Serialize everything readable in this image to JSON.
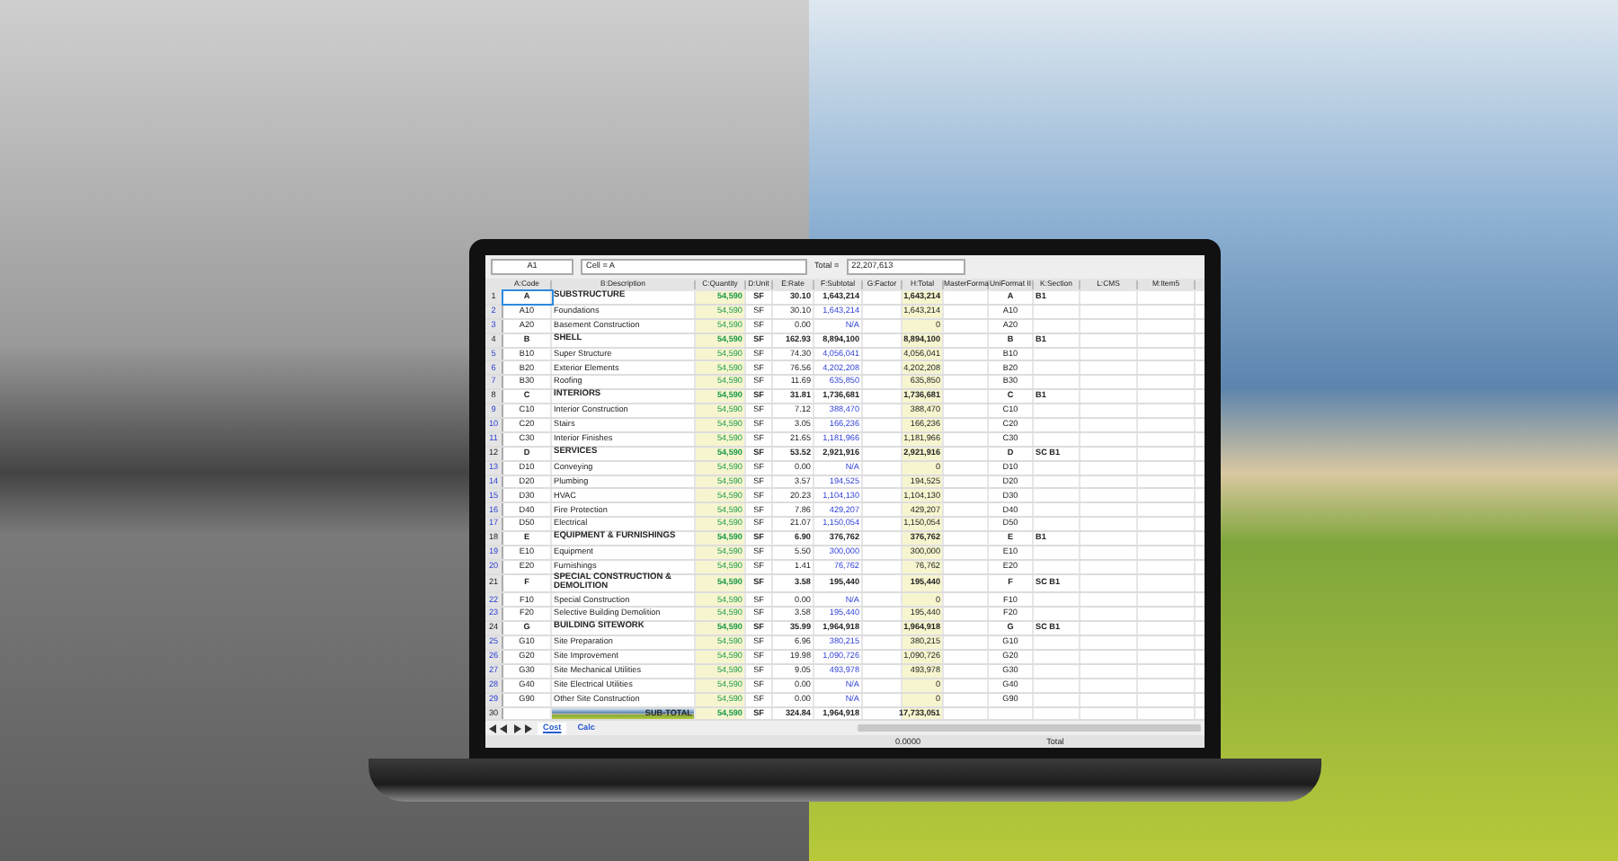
{
  "formula_bar": {
    "cell_ref": "A1",
    "formula": "Cell = A",
    "total_label": "Total =",
    "total_value": "22,207,613"
  },
  "columns": [
    "A:Code",
    "B:Description",
    "C:Quantity",
    "D:Unit",
    "E:Rate",
    "F:Subtotal",
    "G:Factor",
    "H:Total",
    "MasterForma",
    "UniFormat II",
    "K:Section",
    "L:CMS",
    "M:Item5"
  ],
  "rows": [
    {
      "n": "1",
      "kind": "group",
      "selected": true,
      "code": "A",
      "description": "SUBSTRUCTURE",
      "quantity": "54,590",
      "unit": "SF",
      "rate": "30.10",
      "subtotal": "1,643,214",
      "total": "1,643,214",
      "uniformat": "A",
      "section": "B1"
    },
    {
      "n": "2",
      "kind": "item",
      "selected": false,
      "code": "A10",
      "description": "Foundations",
      "quantity": "54,590",
      "unit": "SF",
      "rate": "30.10",
      "subtotal": "1,643,214",
      "total": "1,643,214",
      "uniformat": "A10",
      "section": ""
    },
    {
      "n": "3",
      "kind": "item",
      "selected": false,
      "code": "A20",
      "description": "Basement Construction",
      "quantity": "54,590",
      "unit": "SF",
      "rate": "0.00",
      "subtotal": "N/A",
      "total": "0",
      "uniformat": "A20",
      "section": ""
    },
    {
      "n": "4",
      "kind": "group",
      "selected": false,
      "code": "B",
      "description": "SHELL",
      "quantity": "54,590",
      "unit": "SF",
      "rate": "162.93",
      "subtotal": "8,894,100",
      "total": "8,894,100",
      "uniformat": "B",
      "section": "B1"
    },
    {
      "n": "5",
      "kind": "item",
      "selected": false,
      "code": "B10",
      "description": "Super Structure",
      "quantity": "54,590",
      "unit": "SF",
      "rate": "74.30",
      "subtotal": "4,056,041",
      "total": "4,056,041",
      "uniformat": "B10",
      "section": ""
    },
    {
      "n": "6",
      "kind": "item",
      "selected": false,
      "code": "B20",
      "description": "Exterior Elements",
      "quantity": "54,590",
      "unit": "SF",
      "rate": "76.56",
      "subtotal": "4,202,208",
      "total": "4,202,208",
      "uniformat": "B20",
      "section": ""
    },
    {
      "n": "7",
      "kind": "item",
      "selected": false,
      "code": "B30",
      "description": "Roofing",
      "quantity": "54,590",
      "unit": "SF",
      "rate": "11.69",
      "subtotal": "635,850",
      "total": "635,850",
      "uniformat": "B30",
      "section": ""
    },
    {
      "n": "8",
      "kind": "group",
      "selected": false,
      "code": "C",
      "description": "INTERIORS",
      "quantity": "54,590",
      "unit": "SF",
      "rate": "31.81",
      "subtotal": "1,736,681",
      "total": "1,736,681",
      "uniformat": "C",
      "section": "B1"
    },
    {
      "n": "9",
      "kind": "item",
      "selected": false,
      "code": "C10",
      "description": "Interior Construction",
      "quantity": "54,590",
      "unit": "SF",
      "rate": "7.12",
      "subtotal": "388,470",
      "total": "388,470",
      "uniformat": "C10",
      "section": ""
    },
    {
      "n": "10",
      "kind": "item",
      "selected": false,
      "code": "C20",
      "description": "Stairs",
      "quantity": "54,590",
      "unit": "SF",
      "rate": "3.05",
      "subtotal": "166,236",
      "total": "166,236",
      "uniformat": "C20",
      "section": ""
    },
    {
      "n": "11",
      "kind": "item",
      "selected": false,
      "code": "C30",
      "description": "Interior Finishes",
      "quantity": "54,590",
      "unit": "SF",
      "rate": "21.65",
      "subtotal": "1,181,966",
      "total": "1,181,966",
      "uniformat": "C30",
      "section": ""
    },
    {
      "n": "12",
      "kind": "group",
      "selected": false,
      "code": "D",
      "description": "SERVICES",
      "quantity": "54,590",
      "unit": "SF",
      "rate": "53.52",
      "subtotal": "2,921,916",
      "total": "2,921,916",
      "uniformat": "D",
      "section": "SC B1"
    },
    {
      "n": "13",
      "kind": "item",
      "selected": false,
      "code": "D10",
      "description": "Conveying",
      "quantity": "54,590",
      "unit": "SF",
      "rate": "0.00",
      "subtotal": "N/A",
      "total": "0",
      "uniformat": "D10",
      "section": ""
    },
    {
      "n": "14",
      "kind": "item",
      "selected": false,
      "code": "D20",
      "description": "Plumbing",
      "quantity": "54,590",
      "unit": "SF",
      "rate": "3.57",
      "subtotal": "194,525",
      "total": "194,525",
      "uniformat": "D20",
      "section": ""
    },
    {
      "n": "15",
      "kind": "item",
      "selected": false,
      "code": "D30",
      "description": "HVAC",
      "quantity": "54,590",
      "unit": "SF",
      "rate": "20.23",
      "subtotal": "1,104,130",
      "total": "1,104,130",
      "uniformat": "D30",
      "section": ""
    },
    {
      "n": "16",
      "kind": "item",
      "selected": false,
      "code": "D40",
      "description": "Fire Protection",
      "quantity": "54,590",
      "unit": "SF",
      "rate": "7.86",
      "subtotal": "429,207",
      "total": "429,207",
      "uniformat": "D40",
      "section": ""
    },
    {
      "n": "17",
      "kind": "item",
      "selected": false,
      "code": "D50",
      "description": "Electrical",
      "quantity": "54,590",
      "unit": "SF",
      "rate": "21.07",
      "subtotal": "1,150,054",
      "total": "1,150,054",
      "uniformat": "D50",
      "section": ""
    },
    {
      "n": "18",
      "kind": "group",
      "selected": false,
      "code": "E",
      "description": "EQUIPMENT & FURNISHINGS",
      "quantity": "54,590",
      "unit": "SF",
      "rate": "6.90",
      "subtotal": "376,762",
      "total": "376,762",
      "uniformat": "E",
      "section": "B1"
    },
    {
      "n": "19",
      "kind": "item",
      "selected": false,
      "code": "E10",
      "description": "Equipment",
      "quantity": "54,590",
      "unit": "SF",
      "rate": "5.50",
      "subtotal": "300,000",
      "total": "300,000",
      "uniformat": "E10",
      "section": ""
    },
    {
      "n": "20",
      "kind": "item",
      "selected": false,
      "code": "E20",
      "description": "Furnishings",
      "quantity": "54,590",
      "unit": "SF",
      "rate": "1.41",
      "subtotal": "76,762",
      "total": "76,762",
      "uniformat": "E20",
      "section": ""
    },
    {
      "n": "21",
      "kind": "group",
      "selected": false,
      "code": "F",
      "description": "SPECIAL CONSTRUCTION & DEMOLITION",
      "quantity": "54,590",
      "unit": "SF",
      "rate": "3.58",
      "subtotal": "195,440",
      "total": "195,440",
      "uniformat": "F",
      "section": "SC B1"
    },
    {
      "n": "22",
      "kind": "item",
      "selected": false,
      "code": "F10",
      "description": "Special Construction",
      "quantity": "54,590",
      "unit": "SF",
      "rate": "0.00",
      "subtotal": "N/A",
      "total": "0",
      "uniformat": "F10",
      "section": ""
    },
    {
      "n": "23",
      "kind": "item",
      "selected": false,
      "code": "F20",
      "description": "Selective Building Demolition",
      "quantity": "54,590",
      "unit": "SF",
      "rate": "3.58",
      "subtotal": "195,440",
      "total": "195,440",
      "uniformat": "F20",
      "section": ""
    },
    {
      "n": "24",
      "kind": "group",
      "selected": false,
      "code": "G",
      "description": "BUILDING SITEWORK",
      "quantity": "54,590",
      "unit": "SF",
      "rate": "35.99",
      "subtotal": "1,964,918",
      "total": "1,964,918",
      "uniformat": "G",
      "section": "SC B1"
    },
    {
      "n": "25",
      "kind": "item",
      "selected": false,
      "code": "G10",
      "description": "Site Preparation",
      "quantity": "54,590",
      "unit": "SF",
      "rate": "6.96",
      "subtotal": "380,215",
      "total": "380,215",
      "uniformat": "G10",
      "section": ""
    },
    {
      "n": "26",
      "kind": "item",
      "selected": false,
      "code": "G20",
      "description": "Site Improvement",
      "quantity": "54,590",
      "unit": "SF",
      "rate": "19.98",
      "subtotal": "1,090,726",
      "total": "1,090,726",
      "uniformat": "G20",
      "section": ""
    },
    {
      "n": "27",
      "kind": "item",
      "selected": false,
      "code": "G30",
      "description": "Site Mechanical Utilities",
      "quantity": "54,590",
      "unit": "SF",
      "rate": "9.05",
      "subtotal": "493,978",
      "total": "493,978",
      "uniformat": "G30",
      "section": ""
    },
    {
      "n": "28",
      "kind": "item",
      "selected": false,
      "code": "G40",
      "description": "Site Electrical Utilities",
      "quantity": "54,590",
      "unit": "SF",
      "rate": "0.00",
      "subtotal": "N/A",
      "total": "0",
      "uniformat": "G40",
      "section": ""
    },
    {
      "n": "29",
      "kind": "item",
      "selected": false,
      "code": "G90",
      "description": "Other Site Construction",
      "quantity": "54,590",
      "unit": "SF",
      "rate": "0.00",
      "subtotal": "N/A",
      "total": "0",
      "uniformat": "G90",
      "section": ""
    },
    {
      "n": "30",
      "kind": "total",
      "selected": false,
      "code": "",
      "description": "SUB-TOTAL",
      "quantity": "54,590",
      "unit": "SF",
      "rate": "324.84",
      "subtotal": "1,964,918",
      "total": "17,733,051",
      "uniformat": "",
      "section": ""
    }
  ],
  "sheet_tabs": [
    {
      "label": "Cost",
      "selected": true
    },
    {
      "label": "Calc",
      "selected": false
    }
  ],
  "status_bar": {
    "value": "0.0000",
    "label": "Total"
  }
}
